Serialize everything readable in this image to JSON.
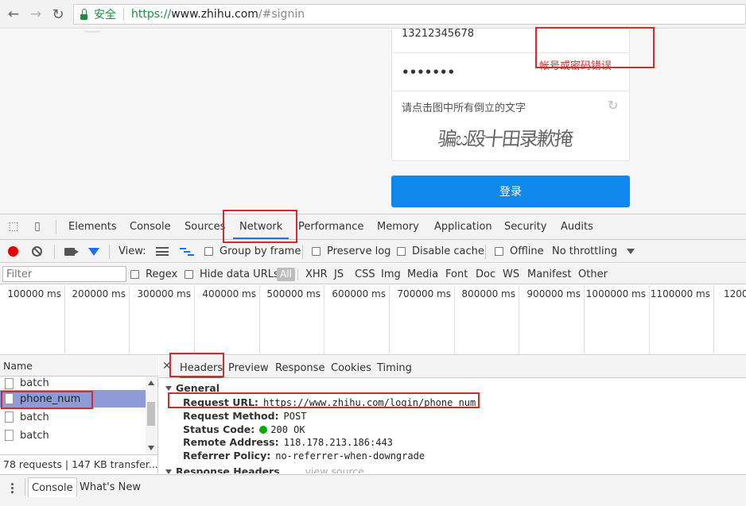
{
  "browser": {
    "secure_label": "安全",
    "url_scheme": "https://",
    "url_host": "www.zhihu.com",
    "url_rest": "/#signin"
  },
  "page": {
    "phone_value": "13212345678",
    "password_masked": "•••••••",
    "error_message": "帐号或密码错误",
    "captcha_prompt": "请点击图中所有倒立的文字",
    "captcha_text": "骗ಬ殴十田录歉掩",
    "login_button": "登录"
  },
  "devtools": {
    "tabs": [
      "Elements",
      "Console",
      "Sources",
      "Network",
      "Performance",
      "Memory",
      "Application",
      "Security",
      "Audits"
    ],
    "active_tab": "Network",
    "toolbar": {
      "view_label": "View:",
      "group_by_frame": "Group by frame",
      "preserve_log": "Preserve log",
      "disable_cache": "Disable cache",
      "offline": "Offline",
      "throttling": "No throttling"
    },
    "filterbar": {
      "filter_placeholder": "Filter",
      "regex": "Regex",
      "hide_data_urls": "Hide data URLs",
      "all": "All",
      "types": [
        "XHR",
        "JS",
        "CSS",
        "Img",
        "Media",
        "Font",
        "Doc",
        "WS",
        "Manifest",
        "Other"
      ]
    },
    "timeline_labels": [
      "100000 ms",
      "200000 ms",
      "300000 ms",
      "400000 ms",
      "500000 ms",
      "600000 ms",
      "700000 ms",
      "800000 ms",
      "900000 ms",
      "1000000 ms",
      "1100000 ms",
      "1200"
    ],
    "name_header": "Name",
    "requests": [
      "batch",
      "phone_num",
      "batch",
      "batch"
    ],
    "selected_request": "phone_num",
    "status_summary": "78 requests | 147 KB transfer...",
    "detail_tabs": [
      "Headers",
      "Preview",
      "Response",
      "Cookies",
      "Timing"
    ],
    "active_detail_tab": "Headers",
    "general": {
      "title": "General",
      "request_url_key": "Request URL:",
      "request_url_val": "https://www.zhihu.com/login/phone_num",
      "request_method_key": "Request Method:",
      "request_method_val": "POST",
      "status_code_key": "Status Code:",
      "status_code_val": "200 OK",
      "remote_address_key": "Remote Address:",
      "remote_address_val": "118.178.213.186:443",
      "referrer_policy_key": "Referrer Policy:",
      "referrer_policy_val": "no-referrer-when-downgrade"
    },
    "response_headers_title": "Response Headers",
    "view_source": "view source",
    "drawer_tabs": [
      "Console",
      "What's New"
    ],
    "active_drawer_tab": "Console"
  },
  "colors": {
    "secure_green": "#1e8e3e",
    "login_blue": "#0f88eb",
    "error_red": "#cc3333",
    "highlight_box": "#d32c2c",
    "record_red": "#e20000",
    "selected_row": "#8f9bd6"
  },
  "icons": [
    "back-arrow-icon",
    "forward-arrow-icon",
    "reload-icon",
    "lock-icon",
    "refresh-icon",
    "inspect-icon",
    "device-icon",
    "record-icon",
    "clear-icon",
    "camera-icon",
    "filter-icon",
    "list-view-icon",
    "waterfall-view-icon",
    "dropdown-icon",
    "close-icon",
    "document-icon",
    "status-dot-icon",
    "drawer-menu-icon"
  ]
}
